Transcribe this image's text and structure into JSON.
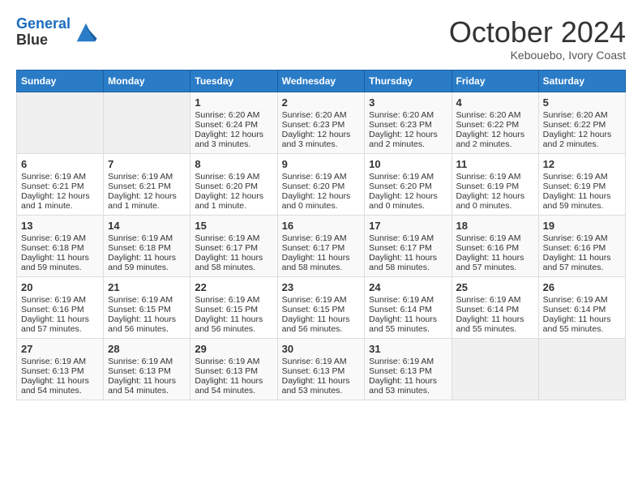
{
  "header": {
    "logo_line1": "General",
    "logo_line2": "Blue",
    "month_title": "October 2024",
    "location": "Kebouebo, Ivory Coast"
  },
  "days_of_week": [
    "Sunday",
    "Monday",
    "Tuesday",
    "Wednesday",
    "Thursday",
    "Friday",
    "Saturday"
  ],
  "weeks": [
    [
      {
        "day": "",
        "content": ""
      },
      {
        "day": "",
        "content": ""
      },
      {
        "day": "1",
        "content": "Sunrise: 6:20 AM\nSunset: 6:24 PM\nDaylight: 12 hours and 3 minutes."
      },
      {
        "day": "2",
        "content": "Sunrise: 6:20 AM\nSunset: 6:23 PM\nDaylight: 12 hours and 3 minutes."
      },
      {
        "day": "3",
        "content": "Sunrise: 6:20 AM\nSunset: 6:23 PM\nDaylight: 12 hours and 2 minutes."
      },
      {
        "day": "4",
        "content": "Sunrise: 6:20 AM\nSunset: 6:22 PM\nDaylight: 12 hours and 2 minutes."
      },
      {
        "day": "5",
        "content": "Sunrise: 6:20 AM\nSunset: 6:22 PM\nDaylight: 12 hours and 2 minutes."
      }
    ],
    [
      {
        "day": "6",
        "content": "Sunrise: 6:19 AM\nSunset: 6:21 PM\nDaylight: 12 hours and 1 minute."
      },
      {
        "day": "7",
        "content": "Sunrise: 6:19 AM\nSunset: 6:21 PM\nDaylight: 12 hours and 1 minute."
      },
      {
        "day": "8",
        "content": "Sunrise: 6:19 AM\nSunset: 6:20 PM\nDaylight: 12 hours and 1 minute."
      },
      {
        "day": "9",
        "content": "Sunrise: 6:19 AM\nSunset: 6:20 PM\nDaylight: 12 hours and 0 minutes."
      },
      {
        "day": "10",
        "content": "Sunrise: 6:19 AM\nSunset: 6:20 PM\nDaylight: 12 hours and 0 minutes."
      },
      {
        "day": "11",
        "content": "Sunrise: 6:19 AM\nSunset: 6:19 PM\nDaylight: 12 hours and 0 minutes."
      },
      {
        "day": "12",
        "content": "Sunrise: 6:19 AM\nSunset: 6:19 PM\nDaylight: 11 hours and 59 minutes."
      }
    ],
    [
      {
        "day": "13",
        "content": "Sunrise: 6:19 AM\nSunset: 6:18 PM\nDaylight: 11 hours and 59 minutes."
      },
      {
        "day": "14",
        "content": "Sunrise: 6:19 AM\nSunset: 6:18 PM\nDaylight: 11 hours and 59 minutes."
      },
      {
        "day": "15",
        "content": "Sunrise: 6:19 AM\nSunset: 6:17 PM\nDaylight: 11 hours and 58 minutes."
      },
      {
        "day": "16",
        "content": "Sunrise: 6:19 AM\nSunset: 6:17 PM\nDaylight: 11 hours and 58 minutes."
      },
      {
        "day": "17",
        "content": "Sunrise: 6:19 AM\nSunset: 6:17 PM\nDaylight: 11 hours and 58 minutes."
      },
      {
        "day": "18",
        "content": "Sunrise: 6:19 AM\nSunset: 6:16 PM\nDaylight: 11 hours and 57 minutes."
      },
      {
        "day": "19",
        "content": "Sunrise: 6:19 AM\nSunset: 6:16 PM\nDaylight: 11 hours and 57 minutes."
      }
    ],
    [
      {
        "day": "20",
        "content": "Sunrise: 6:19 AM\nSunset: 6:16 PM\nDaylight: 11 hours and 57 minutes."
      },
      {
        "day": "21",
        "content": "Sunrise: 6:19 AM\nSunset: 6:15 PM\nDaylight: 11 hours and 56 minutes."
      },
      {
        "day": "22",
        "content": "Sunrise: 6:19 AM\nSunset: 6:15 PM\nDaylight: 11 hours and 56 minutes."
      },
      {
        "day": "23",
        "content": "Sunrise: 6:19 AM\nSunset: 6:15 PM\nDaylight: 11 hours and 56 minutes."
      },
      {
        "day": "24",
        "content": "Sunrise: 6:19 AM\nSunset: 6:14 PM\nDaylight: 11 hours and 55 minutes."
      },
      {
        "day": "25",
        "content": "Sunrise: 6:19 AM\nSunset: 6:14 PM\nDaylight: 11 hours and 55 minutes."
      },
      {
        "day": "26",
        "content": "Sunrise: 6:19 AM\nSunset: 6:14 PM\nDaylight: 11 hours and 55 minutes."
      }
    ],
    [
      {
        "day": "27",
        "content": "Sunrise: 6:19 AM\nSunset: 6:13 PM\nDaylight: 11 hours and 54 minutes."
      },
      {
        "day": "28",
        "content": "Sunrise: 6:19 AM\nSunset: 6:13 PM\nDaylight: 11 hours and 54 minutes."
      },
      {
        "day": "29",
        "content": "Sunrise: 6:19 AM\nSunset: 6:13 PM\nDaylight: 11 hours and 54 minutes."
      },
      {
        "day": "30",
        "content": "Sunrise: 6:19 AM\nSunset: 6:13 PM\nDaylight: 11 hours and 53 minutes."
      },
      {
        "day": "31",
        "content": "Sunrise: 6:19 AM\nSunset: 6:13 PM\nDaylight: 11 hours and 53 minutes."
      },
      {
        "day": "",
        "content": ""
      },
      {
        "day": "",
        "content": ""
      }
    ]
  ]
}
